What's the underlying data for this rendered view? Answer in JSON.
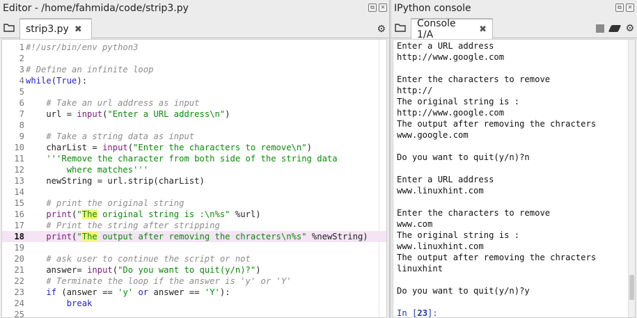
{
  "editor": {
    "title": "Editor - /home/fahmida/code/strip3.py",
    "tab_label": "strip3.py",
    "tab_close": "✖",
    "current_line": 18,
    "lines": [
      {
        "n": "1",
        "segs": [
          {
            "t": "cmt",
            "v": "#!/usr/bin/env python3"
          }
        ]
      },
      {
        "n": "2",
        "segs": []
      },
      {
        "n": "3",
        "segs": [
          {
            "t": "cmt",
            "v": "# Define an infinite loop"
          }
        ]
      },
      {
        "n": "4",
        "segs": [
          {
            "t": "kw",
            "v": "while"
          },
          {
            "t": "ctext",
            "v": "("
          },
          {
            "t": "kw",
            "v": "True"
          },
          {
            "t": "ctext",
            "v": "):"
          }
        ]
      },
      {
        "n": "5",
        "segs": []
      },
      {
        "n": "6",
        "segs": [
          {
            "t": "cmt",
            "v": "    # Take an url address as input"
          }
        ]
      },
      {
        "n": "7",
        "segs": [
          {
            "t": "ctext",
            "v": "    url = "
          },
          {
            "t": "fn",
            "v": "input"
          },
          {
            "t": "ctext",
            "v": "("
          },
          {
            "t": "str",
            "v": "\"Enter a URL address\\n\""
          },
          {
            "t": "ctext",
            "v": ")"
          }
        ]
      },
      {
        "n": "8",
        "segs": []
      },
      {
        "n": "9",
        "segs": [
          {
            "t": "cmt",
            "v": "    # Take a string data as input"
          }
        ]
      },
      {
        "n": "10",
        "segs": [
          {
            "t": "ctext",
            "v": "    charList = "
          },
          {
            "t": "fn",
            "v": "input"
          },
          {
            "t": "ctext",
            "v": "("
          },
          {
            "t": "str",
            "v": "\"Enter the characters to remove\\n\""
          },
          {
            "t": "ctext",
            "v": ")"
          }
        ]
      },
      {
        "n": "11",
        "segs": [
          {
            "t": "str",
            "v": "    '''Remove the character from both side of the string data"
          }
        ]
      },
      {
        "n": "12",
        "segs": [
          {
            "t": "str",
            "v": "        where matches'''"
          }
        ]
      },
      {
        "n": "13",
        "segs": [
          {
            "t": "ctext",
            "v": "    newString = url.strip(charList)"
          }
        ]
      },
      {
        "n": "14",
        "segs": []
      },
      {
        "n": "15",
        "segs": [
          {
            "t": "cmt",
            "v": "    # print the original string"
          }
        ]
      },
      {
        "n": "16",
        "segs": [
          {
            "t": "ctext",
            "v": "    "
          },
          {
            "t": "fn",
            "v": "print"
          },
          {
            "t": "ctext",
            "v": "("
          },
          {
            "t": "str",
            "v": "\""
          },
          {
            "t": "match",
            "v": "The"
          },
          {
            "t": "str",
            "v": " original string is :\\n%s\""
          },
          {
            "t": "ctext",
            "v": " %url)"
          }
        ]
      },
      {
        "n": "17",
        "segs": [
          {
            "t": "cmt",
            "v": "    # Print the string after stripping"
          }
        ]
      },
      {
        "n": "18",
        "segs": [
          {
            "t": "ctext",
            "v": "    "
          },
          {
            "t": "fn",
            "v": "print"
          },
          {
            "t": "ctext",
            "v": "("
          },
          {
            "t": "str",
            "v": "\""
          },
          {
            "t": "match",
            "v": "The"
          },
          {
            "t": "str",
            "v": " output after removing the chracters\\n%s\""
          },
          {
            "t": "ctext",
            "v": " %newString)"
          }
        ]
      },
      {
        "n": "19",
        "segs": []
      },
      {
        "n": "20",
        "segs": [
          {
            "t": "cmt",
            "v": "    # ask user to continue the script or not"
          }
        ]
      },
      {
        "n": "21",
        "segs": [
          {
            "t": "ctext",
            "v": "    answer= "
          },
          {
            "t": "fn",
            "v": "input"
          },
          {
            "t": "ctext",
            "v": "("
          },
          {
            "t": "str",
            "v": "\"Do you want to quit(y/n)?\""
          },
          {
            "t": "ctext",
            "v": ")"
          }
        ]
      },
      {
        "n": "22",
        "segs": [
          {
            "t": "cmt",
            "v": "    # Terminate the loop if the answer is 'y' or 'Y'"
          }
        ]
      },
      {
        "n": "23",
        "segs": [
          {
            "t": "ctext",
            "v": "    "
          },
          {
            "t": "kw",
            "v": "if"
          },
          {
            "t": "ctext",
            "v": " (answer == "
          },
          {
            "t": "str",
            "v": "'y'"
          },
          {
            "t": "ctext",
            "v": " "
          },
          {
            "t": "kw",
            "v": "or"
          },
          {
            "t": "ctext",
            "v": " answer == "
          },
          {
            "t": "str",
            "v": "'Y'"
          },
          {
            "t": "ctext",
            "v": "):"
          }
        ]
      },
      {
        "n": "24",
        "segs": [
          {
            "t": "kw",
            "v": "        break"
          }
        ]
      },
      {
        "n": "25",
        "segs": []
      }
    ]
  },
  "console": {
    "title": "IPython console",
    "tab_label": "Console 1/A",
    "tab_close": "✖",
    "lines": [
      "Enter a URL address",
      "http://www.google.com",
      "",
      "Enter the characters to remove",
      "http://",
      "The original string is :",
      "http://www.google.com",
      "The output after removing the chracters",
      "www.google.com",
      "",
      "Do you want to quit(y/n)?n",
      "",
      "Enter a URL address",
      "www.linuxhint.com",
      "",
      "Enter the characters to remove",
      "www.com",
      "The original string is :",
      "www.linuxhint.com",
      "The output after removing the chracters",
      "linuxhint",
      "",
      "Do you want to quit(y/n)?y",
      ""
    ],
    "prompt_prefix": "In [",
    "prompt_number": "23",
    "prompt_suffix": "]:"
  },
  "icons": {
    "undock": "undock-icon",
    "close_pane": "close-pane-icon",
    "browse_tabs": "folder-browse-icon",
    "options": "gear-icon",
    "stop": "stop-icon",
    "clear": "eraser-icon"
  }
}
